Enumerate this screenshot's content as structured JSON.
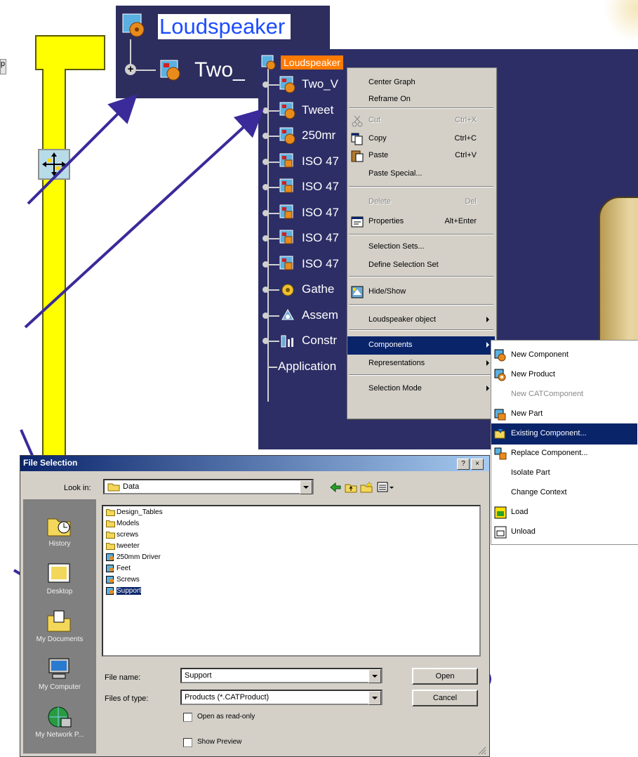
{
  "edge_label": "p",
  "zoom": {
    "root_label": "Loudspeaker",
    "child_label": "Two_"
  },
  "tree": {
    "root_label": "Loudspeaker",
    "items": [
      {
        "label": "Two_V",
        "icon": "product-icon"
      },
      {
        "label": "Tweet",
        "icon": "product-icon"
      },
      {
        "label": "250mr",
        "icon": "product-icon"
      },
      {
        "label": "ISO 47",
        "icon": "part-icon"
      },
      {
        "label": "ISO 47",
        "icon": "part-icon"
      },
      {
        "label": "ISO 47",
        "icon": "part-icon"
      },
      {
        "label": "ISO 47",
        "icon": "part-icon"
      },
      {
        "label": "ISO 47",
        "icon": "part-icon"
      },
      {
        "label": "Gathe",
        "icon": "gather-icon"
      },
      {
        "label": "Assem",
        "icon": "assembly-icon"
      },
      {
        "label": "Constr",
        "icon": "constraints-icon"
      },
      {
        "label": "Application",
        "icon": ""
      }
    ]
  },
  "context_menu": {
    "items": [
      {
        "label": "Center Graph",
        "shortcut": ""
      },
      {
        "label": "Reframe On",
        "shortcut": ""
      },
      {
        "label": "Cut",
        "shortcut": "Ctrl+X",
        "disabled": true
      },
      {
        "label": "Copy",
        "shortcut": "Ctrl+C"
      },
      {
        "label": "Paste",
        "shortcut": "Ctrl+V"
      },
      {
        "label": "Paste Special...",
        "shortcut": ""
      },
      {
        "label": "Delete",
        "shortcut": "Del",
        "disabled": true
      },
      {
        "label": "Properties",
        "shortcut": "Alt+Enter"
      },
      {
        "label": "Selection Sets...",
        "shortcut": ""
      },
      {
        "label": "Define Selection Set",
        "shortcut": ""
      },
      {
        "label": "Hide/Show",
        "shortcut": ""
      },
      {
        "label": "Loudspeaker object",
        "shortcut": ""
      },
      {
        "label": "Components",
        "shortcut": ""
      },
      {
        "label": "Representations",
        "shortcut": ""
      },
      {
        "label": "Selection Mode",
        "shortcut": ""
      }
    ]
  },
  "components_submenu": {
    "items": [
      {
        "label": "New Component"
      },
      {
        "label": "New Product"
      },
      {
        "label": "New CATComponent",
        "disabled": true
      },
      {
        "label": "New Part"
      },
      {
        "label": "Existing Component..."
      },
      {
        "label": "Replace Component..."
      },
      {
        "label": "Isolate Part"
      },
      {
        "label": "Change Context"
      },
      {
        "label": "Load"
      },
      {
        "label": "Unload"
      }
    ]
  },
  "file_dialog": {
    "title": "File Selection",
    "help_btn": "?",
    "close_btn": "×",
    "look_in_label": "Look in:",
    "look_in_value": "Data",
    "places": [
      "History",
      "Desktop",
      "My Documents",
      "My Computer",
      "My Network P..."
    ],
    "files": [
      {
        "name": "Design_Tables",
        "type": "folder"
      },
      {
        "name": "Models",
        "type": "folder"
      },
      {
        "name": "screws",
        "type": "folder"
      },
      {
        "name": "tweeter",
        "type": "folder"
      },
      {
        "name": "250mm Driver",
        "type": "product"
      },
      {
        "name": "Feet",
        "type": "product"
      },
      {
        "name": "Screws",
        "type": "product"
      },
      {
        "name": "Support",
        "type": "product"
      }
    ],
    "selected_file": "Support",
    "file_name_label": "File name:",
    "file_name_value": "Support",
    "file_type_label": "Files of type:",
    "file_type_value": "Products (*.CATProduct)",
    "open_btn": "Open",
    "cancel_btn": "Cancel",
    "readonly_label": "Open as read-only",
    "preview_label": "Show Preview"
  },
  "colors": {
    "accent_arrow": "#3a2a9a",
    "tree_bg": "#2d2e5e",
    "selection": "#0a246a",
    "orange_highlight": "#ff7a00"
  }
}
